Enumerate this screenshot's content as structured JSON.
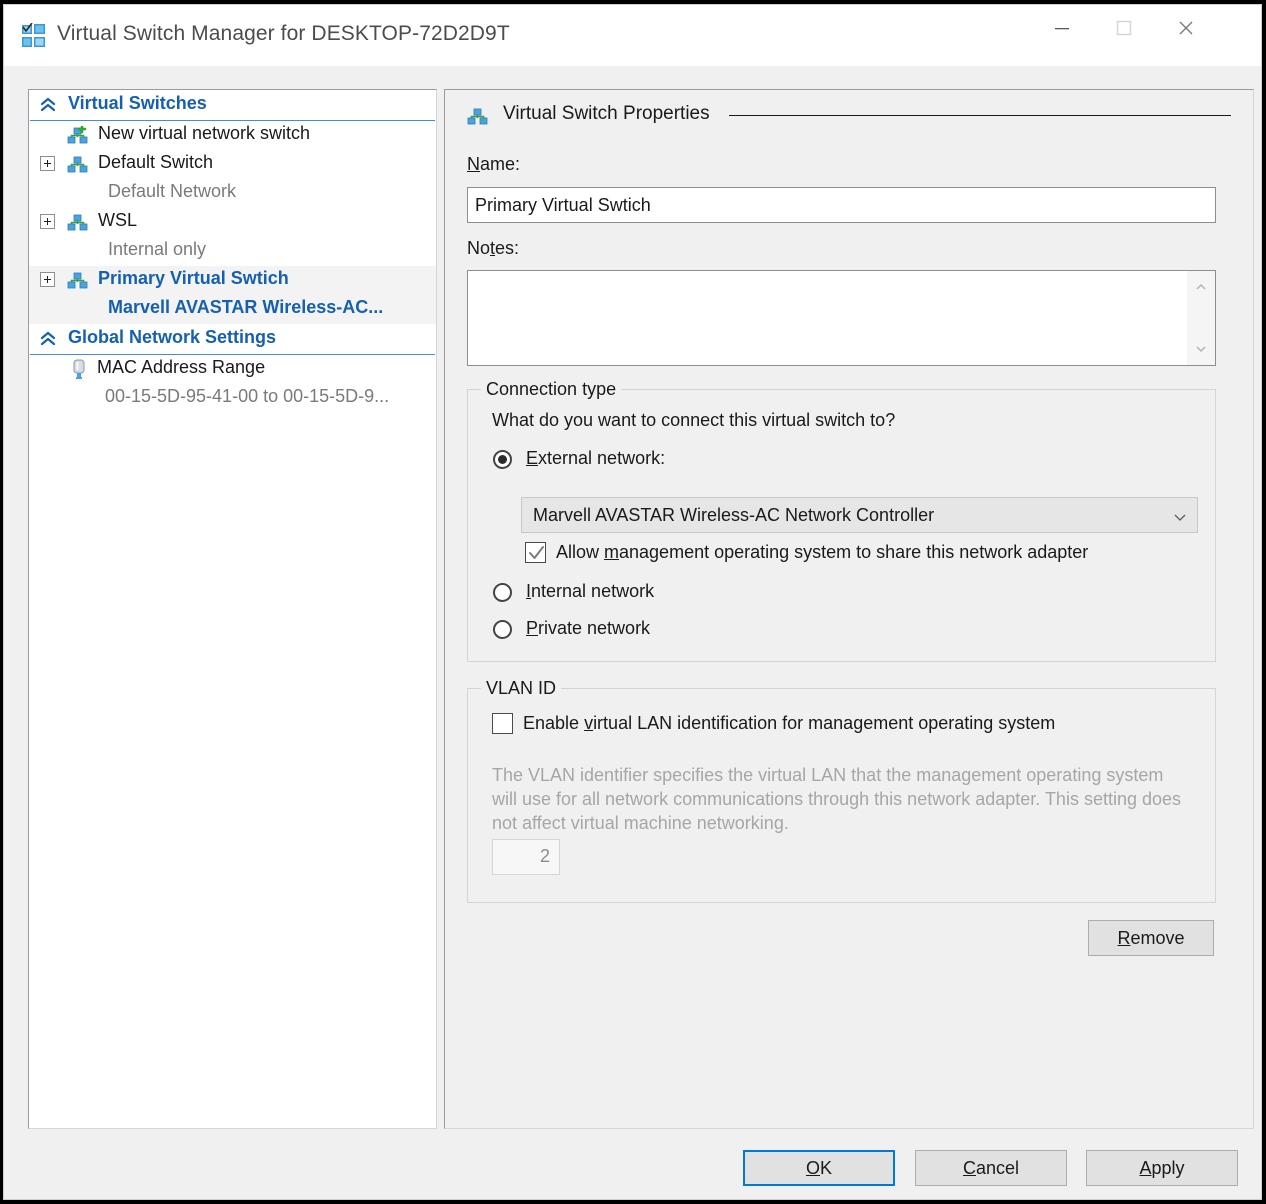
{
  "window": {
    "title": "Virtual Switch Manager for DESKTOP-72D2D9T",
    "icon": "virtual-switch-manager-icon",
    "controls": {
      "minimize": "minimize-icon",
      "maximize": "maximize-icon",
      "close": "close-icon"
    }
  },
  "tree": {
    "groups": [
      {
        "label": "Virtual Switches",
        "chevron": "chevron-double-up-icon",
        "items": [
          {
            "label": "New virtual network switch",
            "icon": "new-virtual-switch-icon",
            "expandable": false,
            "sub": null,
            "selected": false
          },
          {
            "label": "Default Switch",
            "icon": "virtual-switch-icon",
            "expandable": true,
            "sub": "Default Network",
            "selected": false
          },
          {
            "label": "WSL",
            "icon": "virtual-switch-icon",
            "expandable": true,
            "sub": "Internal only",
            "selected": false
          },
          {
            "label": "Primary Virtual Swtich",
            "icon": "virtual-switch-icon",
            "expandable": true,
            "sub": "Marvell AVASTAR Wireless-AC...",
            "selected": true
          }
        ]
      },
      {
        "label": "Global Network Settings",
        "chevron": "chevron-double-up-icon",
        "items": [
          {
            "label": "MAC Address Range",
            "icon": "mac-address-icon",
            "expandable": false,
            "sub": "00-15-5D-95-41-00 to 00-15-5D-9...",
            "selected": false
          }
        ]
      }
    ]
  },
  "properties": {
    "header": "Virtual Switch Properties",
    "header_icon": "virtual-switch-icon",
    "name_label": "Name:",
    "name_value": "Primary Virtual Swtich",
    "notes_label": "Notes:",
    "notes_value": "",
    "connection": {
      "group_title": "Connection type",
      "question": "What do you want to connect this virtual switch to?",
      "options": [
        {
          "label": "External network:",
          "selected": true
        },
        {
          "label": "Internal network",
          "selected": false
        },
        {
          "label": "Private network",
          "selected": false
        }
      ],
      "adapter_value": "Marvell AVASTAR Wireless-AC Network Controller",
      "adapter_arrow": "chevron-down-icon",
      "share_checkbox_label": "Allow management operating system to share this network adapter",
      "share_checkbox_checked": true
    },
    "vlan": {
      "group_title": "VLAN ID",
      "enable_label": "Enable virtual LAN identification for management operating system",
      "enable_checked": false,
      "description": "The VLAN identifier specifies the virtual LAN that the management operating system will use for all network communications through this network adapter. This setting does not affect virtual machine networking.",
      "vlan_value": "2"
    },
    "remove_label": "Remove"
  },
  "footer": {
    "ok_label": "OK",
    "cancel_label": "Cancel",
    "apply_label": "Apply"
  },
  "colors": {
    "accent": "#1560b0",
    "focus": "#0078d7",
    "window_bg": "#f0f0f0",
    "panel_bg": "#ffffff"
  }
}
